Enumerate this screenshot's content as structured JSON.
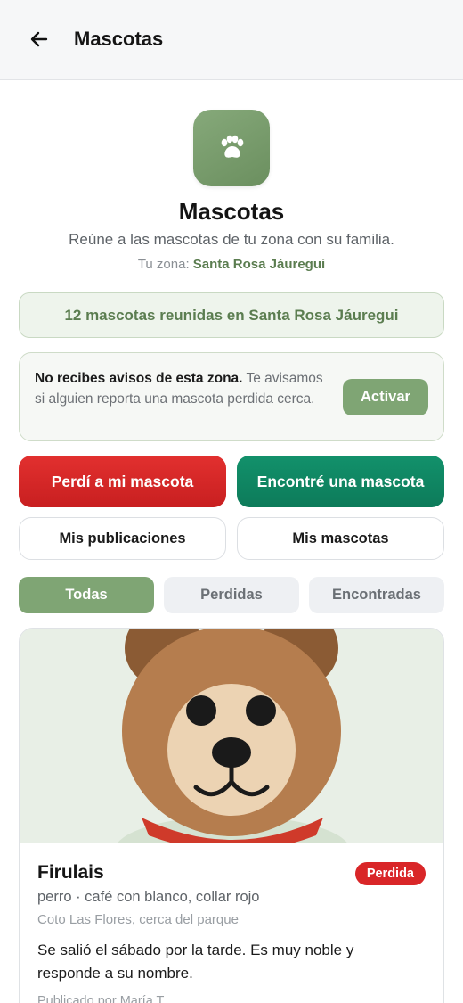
{
  "header": {
    "title": "Mascotas",
    "back_icon": "arrow-left-icon"
  },
  "hero": {
    "icon": "paw-icon",
    "title": "Mascotas",
    "subtitle": "Reúne a las mascotas de tu zona con su familia.",
    "zone_label": "Tu zona:",
    "zone_name": "Santa Rosa Jáuregui"
  },
  "stats": {
    "text": "12 mascotas reunidas en Santa Rosa Jáuregui"
  },
  "alert": {
    "title": "No recibes avisos de esta zona.",
    "message": "Te avisamos si alguien reporta una mascota perdida cerca.",
    "button_label": "Activar"
  },
  "actions": {
    "lost_label": "Perdí a mi mascota",
    "found_label": "Encontré una mascota",
    "my_posts_label": "Mis publicaciones",
    "my_pets_label": "Mis mascotas"
  },
  "filters": {
    "all": "Todas",
    "lost": "Perdidas",
    "found": "Encontradas",
    "selected": "Todas"
  },
  "post": {
    "name": "Firulais",
    "status": "Perdida",
    "details": "perro · café con blanco, collar rojo",
    "location": "Coto Las Flores, cerca del parque",
    "description": "Se salió el sábado por la tarde. Es muy noble y responde a su nombre.",
    "author": "Publicado por María T."
  },
  "colors": {
    "accent_green": "#7fa574",
    "lost_red": "#d92628",
    "found_green": "#0f8a64",
    "header_bg": "#f6f7f8"
  }
}
